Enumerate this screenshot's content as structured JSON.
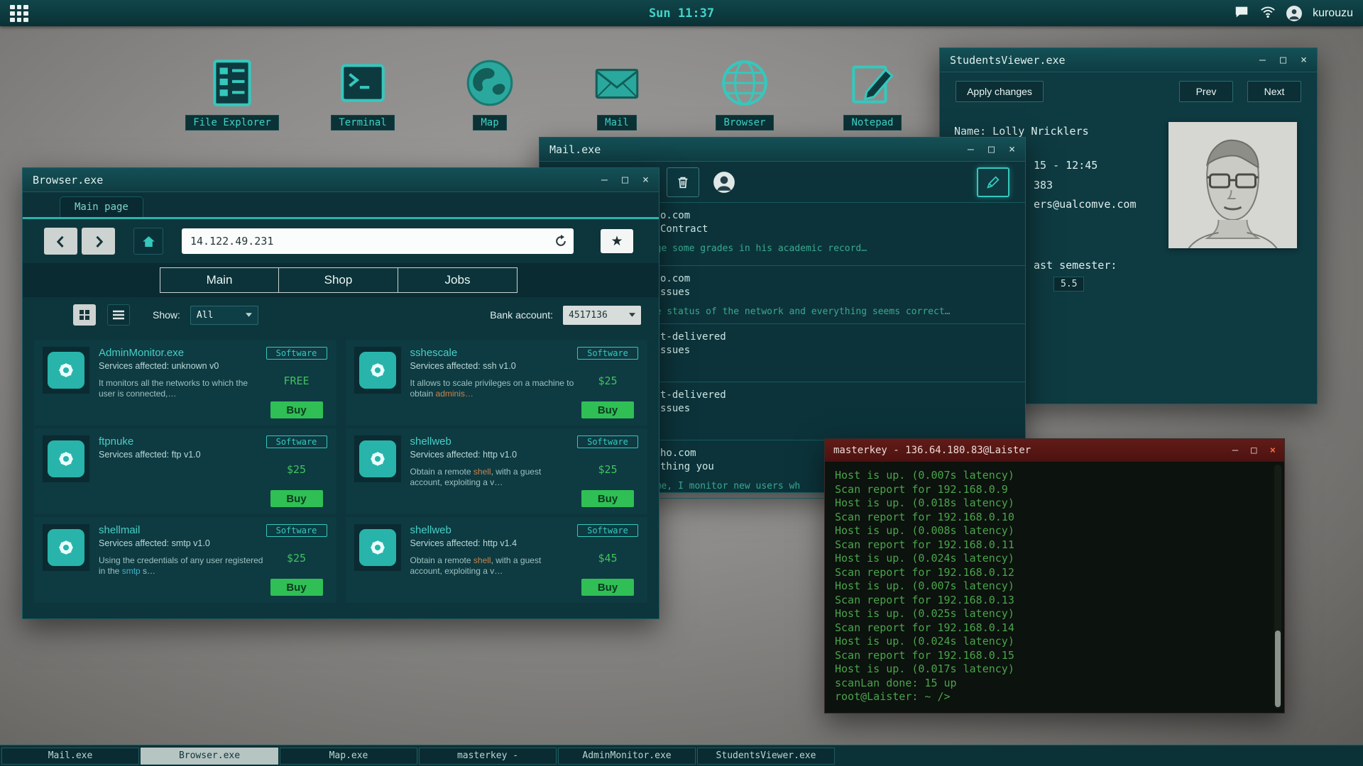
{
  "window_controls": {
    "minimize": "—",
    "maximize": "□",
    "close": "×"
  },
  "topbar": {
    "clock": "Sun 11:37",
    "username": "kurouzu"
  },
  "desktop_icons": [
    {
      "label": "File Explorer"
    },
    {
      "label": "Terminal"
    },
    {
      "label": "Map"
    },
    {
      "label": "Mail"
    },
    {
      "label": "Browser"
    },
    {
      "label": "Notepad"
    }
  ],
  "browser": {
    "title": "Browser.exe",
    "tab": "Main page",
    "url": "14.122.49.231",
    "nav_tabs": [
      "Main",
      "Shop",
      "Jobs"
    ],
    "show_label": "Show:",
    "show_value": "All",
    "bank_label": "Bank account:",
    "bank_value": "4517136",
    "badge": "Software",
    "buy_label": "Buy",
    "items": [
      {
        "name": "AdminMonitor.exe",
        "services": "Services affected: unknown v0",
        "price": "FREE",
        "desc_a": "It monitors all the networks to which the user is connected,…",
        "desc_hl": "",
        "desc_b": ""
      },
      {
        "name": "sshescale",
        "services": "Services affected: ssh v1.0",
        "price": "$25",
        "desc_a": "It allows to scale privileges on a machine to obtain ",
        "desc_hl": "adminis…",
        "desc_b": ""
      },
      {
        "name": "ftpnuke",
        "services": "Services affected: ftp v1.0",
        "price": "$25",
        "desc_a": "",
        "desc_hl": "",
        "desc_b": ""
      },
      {
        "name": "shellweb",
        "services": "Services affected: http v1.0",
        "price": "$25",
        "desc_a": "Obtain a remote ",
        "desc_hl": "shell",
        "desc_b": ", with a guest account, exploiting a v…"
      },
      {
        "name": "shellmail",
        "services": "Services affected: smtp v1.0",
        "price": "$25",
        "desc_a": "Using the credentials of any user registered in the ",
        "desc_hl": "smtp",
        "desc_b": " s…"
      },
      {
        "name": "shellweb",
        "services": "Services affected: http v1.4",
        "price": "$45",
        "desc_a": "Obtain a remote ",
        "desc_hl": "shell",
        "desc_b": ", with a guest account, exploiting a v…"
      }
    ]
  },
  "mail": {
    "title": "Mail.exe",
    "rows": [
      {
        "sender": "o.com",
        "subject": "Contract",
        "preview": "ange some grades in his academic record…"
      },
      {
        "sender": "o.com",
        "subject": "ssues",
        "preview": "the status of the network and everything seems correct…"
      },
      {
        "sender": "t-delivered",
        "subject": "ssues",
        "preview": ""
      },
      {
        "sender": "t-delivered",
        "subject": "ssues",
        "preview": ""
      },
      {
        "sender": "ho.com",
        "subject": "thing you",
        "preview": "e me, I monitor new users wh"
      }
    ]
  },
  "students_viewer": {
    "title": "StudentsViewer.exe",
    "apply_button": "Apply changes",
    "prev_button": "Prev",
    "next_button": "Next",
    "name_line": "Name: Lolly Nricklers",
    "fragment_schedule": "15 - 12:45",
    "fragment_id": "383",
    "fragment_email": "ers@ualcomve.com",
    "fragment_semester": "ast semester:",
    "grade": "5.5"
  },
  "terminal": {
    "title": "masterkey - 136.64.180.83@Laister",
    "lines": [
      "Host is up. (0.007s latency)",
      "Scan report for 192.168.0.9",
      "Host is up. (0.018s latency)",
      "Scan report for 192.168.0.10",
      "Host is up. (0.008s latency)",
      "Scan report for 192.168.0.11",
      "Host is up. (0.024s latency)",
      "Scan report for 192.168.0.12",
      "Host is up. (0.007s latency)",
      "Scan report for 192.168.0.13",
      "Host is up. (0.025s latency)",
      "Scan report for 192.168.0.14",
      "Host is up. (0.024s latency)",
      "Scan report for 192.168.0.15",
      "Host is up. (0.017s latency)",
      "scanLan done: 15 up",
      "root@Laister: ~ />"
    ]
  },
  "taskbar": {
    "items": [
      {
        "label": "Mail.exe"
      },
      {
        "label": "Browser.exe"
      },
      {
        "label": "Map.exe"
      },
      {
        "label": "masterkey -"
      },
      {
        "label": "AdminMonitor.exe"
      },
      {
        "label": "StudentsViewer.exe"
      }
    ]
  },
  "colors": {
    "accent_teal": "#35c8bd",
    "price_green": "#3fc35c",
    "buy_green": "#2fbf55",
    "terminal_green": "#4aa44c",
    "terminal_titlebar": "#5c1614",
    "highlight_orange": "#c9854a",
    "highlight_teal": "#3fb2c4"
  }
}
